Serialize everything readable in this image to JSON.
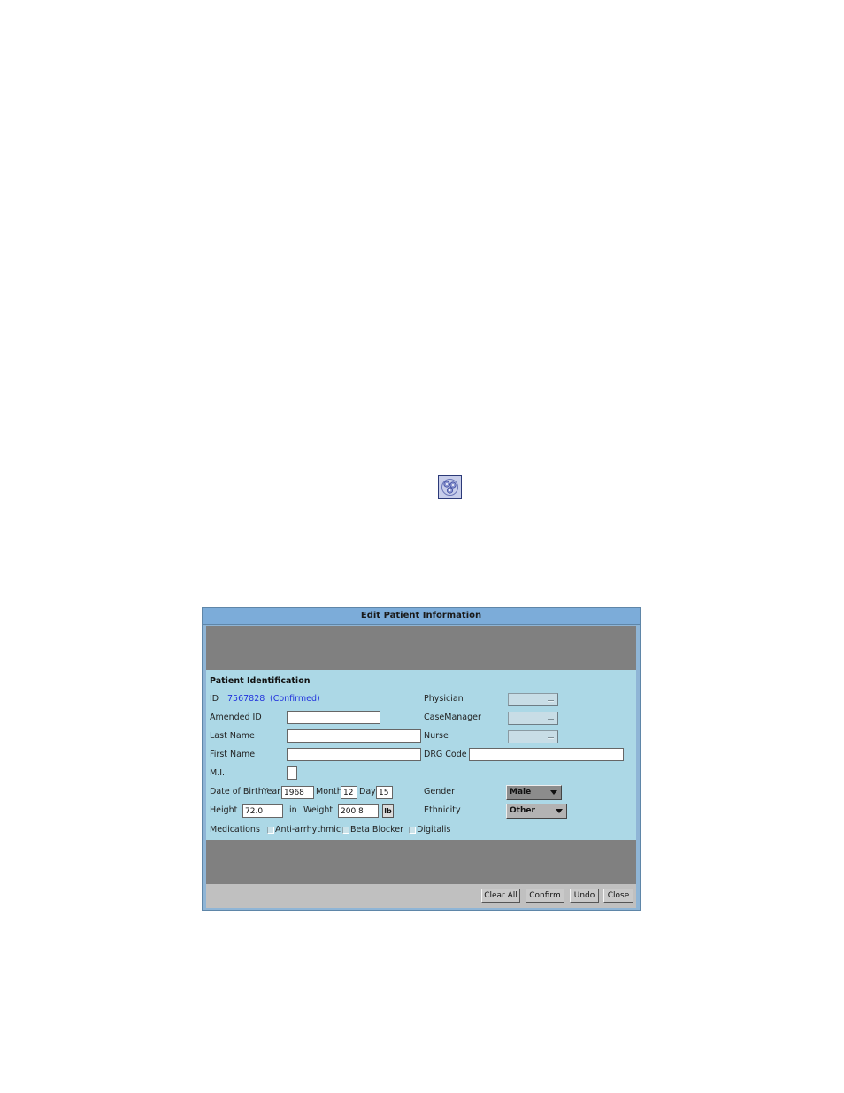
{
  "dialog": {
    "title": "Edit Patient Information"
  },
  "section": {
    "title": "Patient Identification"
  },
  "id_row": {
    "label": "ID",
    "value": "7567828",
    "status": "(Confirmed)"
  },
  "fields": {
    "amended_id": {
      "label": "Amended ID",
      "value": ""
    },
    "last_name": {
      "label": "Last Name",
      "value": ""
    },
    "first_name": {
      "label": "First Name",
      "value": ""
    },
    "mi": {
      "label": "M.I.",
      "value": ""
    }
  },
  "dob": {
    "label": "Date of Birth",
    "year_label": "Year",
    "year": "1968",
    "month_label": "Month",
    "month": "12",
    "day_label": "Day",
    "day": "15"
  },
  "measures": {
    "height_label": "Height",
    "height": "72.0",
    "height_unit": "in",
    "weight_label": "Weight",
    "weight": "200.8",
    "weight_unit": "lb"
  },
  "medications": {
    "label": "Medications",
    "options": [
      {
        "label": "Anti-arrhythmic",
        "checked": false
      },
      {
        "label": "Beta Blocker",
        "checked": false
      },
      {
        "label": "Digitalis",
        "checked": false
      }
    ]
  },
  "right_column": {
    "physician_label": "Physician",
    "case_manager_label": "CaseManager",
    "nurse_label": "Nurse",
    "drg_label": "DRG Code",
    "drg_value": "",
    "gender_label": "Gender",
    "gender_value": "Male",
    "ethnicity_label": "Ethnicity",
    "ethnicity_value": "Other"
  },
  "buttons": {
    "clear_all": "Clear All",
    "confirm": "Confirm",
    "undo": "Undo",
    "close": "Close"
  },
  "icons": {
    "desktop_icon": "molecule-icon"
  },
  "colors": {
    "title_bar": "#7cacd9",
    "panel": "#acd8e6",
    "band": "#808080",
    "button_bar": "#c0c0c0",
    "id_text": "#2233dd"
  }
}
